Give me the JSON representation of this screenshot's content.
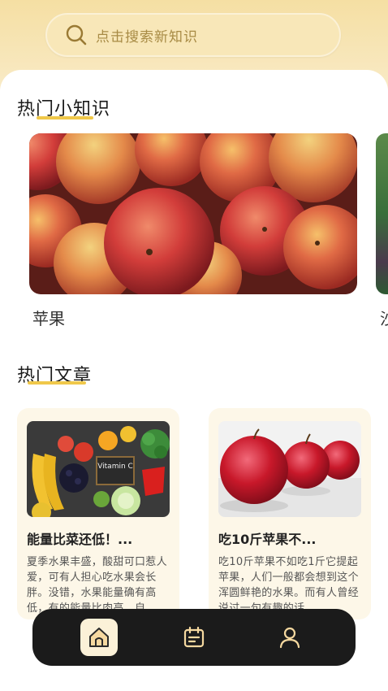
{
  "search": {
    "placeholder": "点击搜索新知识"
  },
  "tips_section": {
    "title": "热门小知识",
    "cards": [
      {
        "label": "苹果"
      },
      {
        "label": "沙"
      }
    ]
  },
  "articles_section": {
    "title": "热门文章",
    "articles": [
      {
        "title": "能量比菜还低！...",
        "desc": "夏季水果丰盛，酸甜可口惹人爱，可有人担心吃水果会长胖。没错，水果能量确有高低，有的能量比肉高，自"
      },
      {
        "title": "吃10斤苹果不...",
        "desc": "吃10斤苹果不如吃1斤它提起苹果，人们一般都会想到这个浑圆鲜艳的水果。而有人曾经说过一句有趣的话"
      }
    ]
  },
  "vitamin_sign": "Vitamin C",
  "nav": {
    "items": [
      {
        "name": "home",
        "icon": "home-icon",
        "active": true
      },
      {
        "name": "calendar",
        "icon": "calendar-icon",
        "active": false
      },
      {
        "name": "profile",
        "icon": "user-icon",
        "active": false
      }
    ]
  },
  "colors": {
    "accent": "#f0c84a",
    "header_bg": "#f5dfa3",
    "nav_bg": "#1b1b1b",
    "card_bg": "#fdf7e8"
  }
}
